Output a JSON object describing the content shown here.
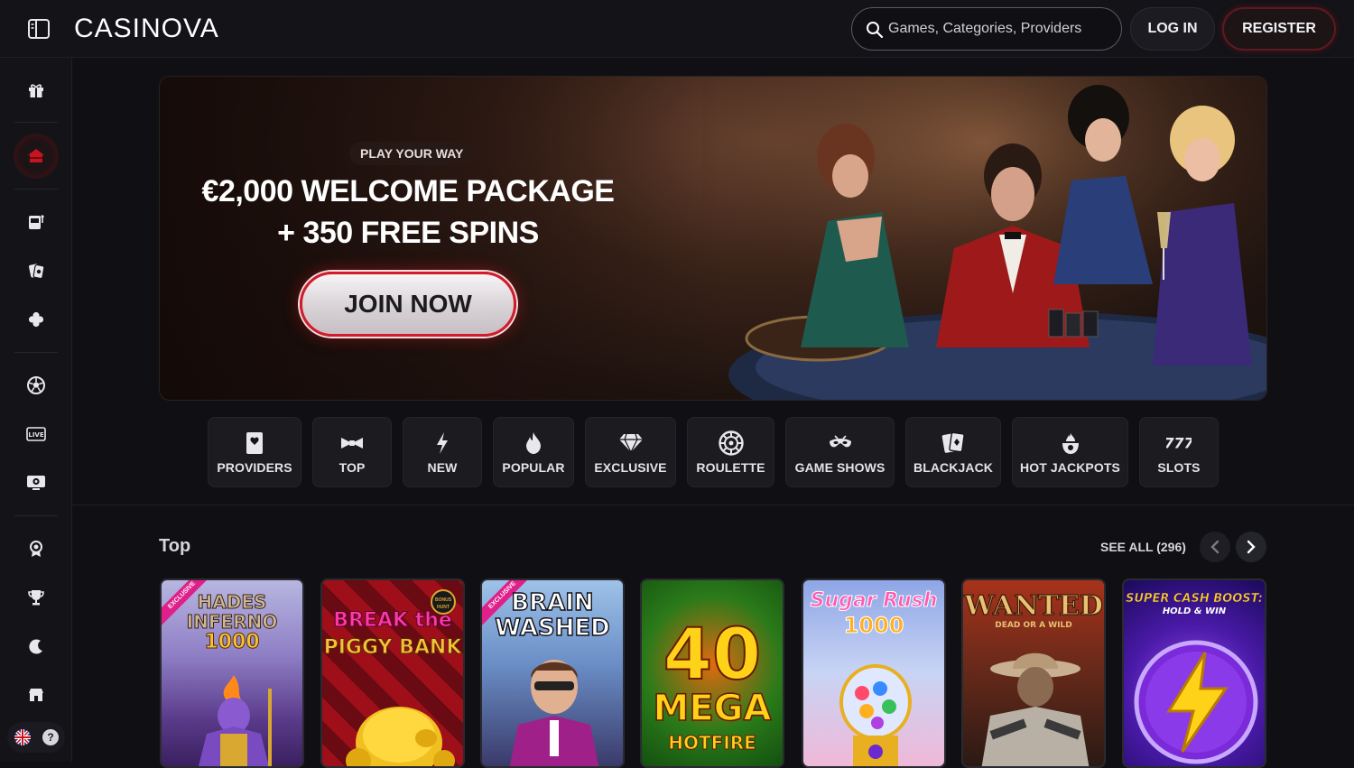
{
  "header": {
    "logo_text": "CASINOVA",
    "search_placeholder": "Games, Categories, Providers",
    "login_label": "LOG IN",
    "register_label": "REGISTER"
  },
  "sidebar": {
    "icons": [
      "gift-icon",
      "home-icon",
      "slot-machine-icon",
      "poker-chip-icon",
      "clover-icon",
      "sports-ball-icon",
      "live-icon",
      "tv-casino-icon",
      "badge-icon",
      "trophy-icon",
      "moon-icon",
      "shop-icon"
    ],
    "help_label": "?"
  },
  "hero": {
    "eyebrow": "PLAY YOUR WAY",
    "headline_line1": "€2,000 WELCOME PACKAGE",
    "headline_line2": "+ 350 FREE SPINS",
    "cta_label": "JOIN NOW"
  },
  "categories": [
    {
      "label": "PROVIDERS",
      "icon": "providers-icon"
    },
    {
      "label": "TOP",
      "icon": "bow-tie-icon"
    },
    {
      "label": "NEW",
      "icon": "lightning-icon"
    },
    {
      "label": "POPULAR",
      "icon": "flame-icon"
    },
    {
      "label": "EXCLUSIVE",
      "icon": "diamond-icon"
    },
    {
      "label": "ROULETTE",
      "icon": "roulette-icon"
    },
    {
      "label": "GAME SHOWS",
      "icon": "mask-icon"
    },
    {
      "label": "BLACKJACK",
      "icon": "cards-icon"
    },
    {
      "label": "HOT JACKPOTS",
      "icon": "hot-pot-icon"
    },
    {
      "label": "SLOTS",
      "icon": "777-icon"
    }
  ],
  "top_section": {
    "title": "Top",
    "see_all_label": "SEE ALL (296)"
  },
  "games": [
    {
      "title_line1": "HADES",
      "title_line2": "INFERNO",
      "title_line3": "1000",
      "badge": "EXCLUSIVE"
    },
    {
      "title_line1": "BREAK the",
      "title_line2": "PIGGY BANK",
      "title_line3": "",
      "badge": "BONUS HUNT"
    },
    {
      "title_line1": "BRAIN",
      "title_line2": "WASHED",
      "title_line3": "",
      "badge": "EXCLUSIVE"
    },
    {
      "title_line1": "40",
      "title_line2": "MEGA",
      "title_line3": "HOTFIRE",
      "badge": ""
    },
    {
      "title_line1": "Sugar Rush",
      "title_line2": "1000",
      "title_line3": "",
      "badge": ""
    },
    {
      "title_line1": "WANTED",
      "title_line2": "DEAD OR A WILD",
      "title_line3": "",
      "badge": ""
    },
    {
      "title_line1": "SUPER CASH BOOST:",
      "title_line2": "HOLD & WIN",
      "title_line3": "",
      "badge": ""
    }
  ]
}
